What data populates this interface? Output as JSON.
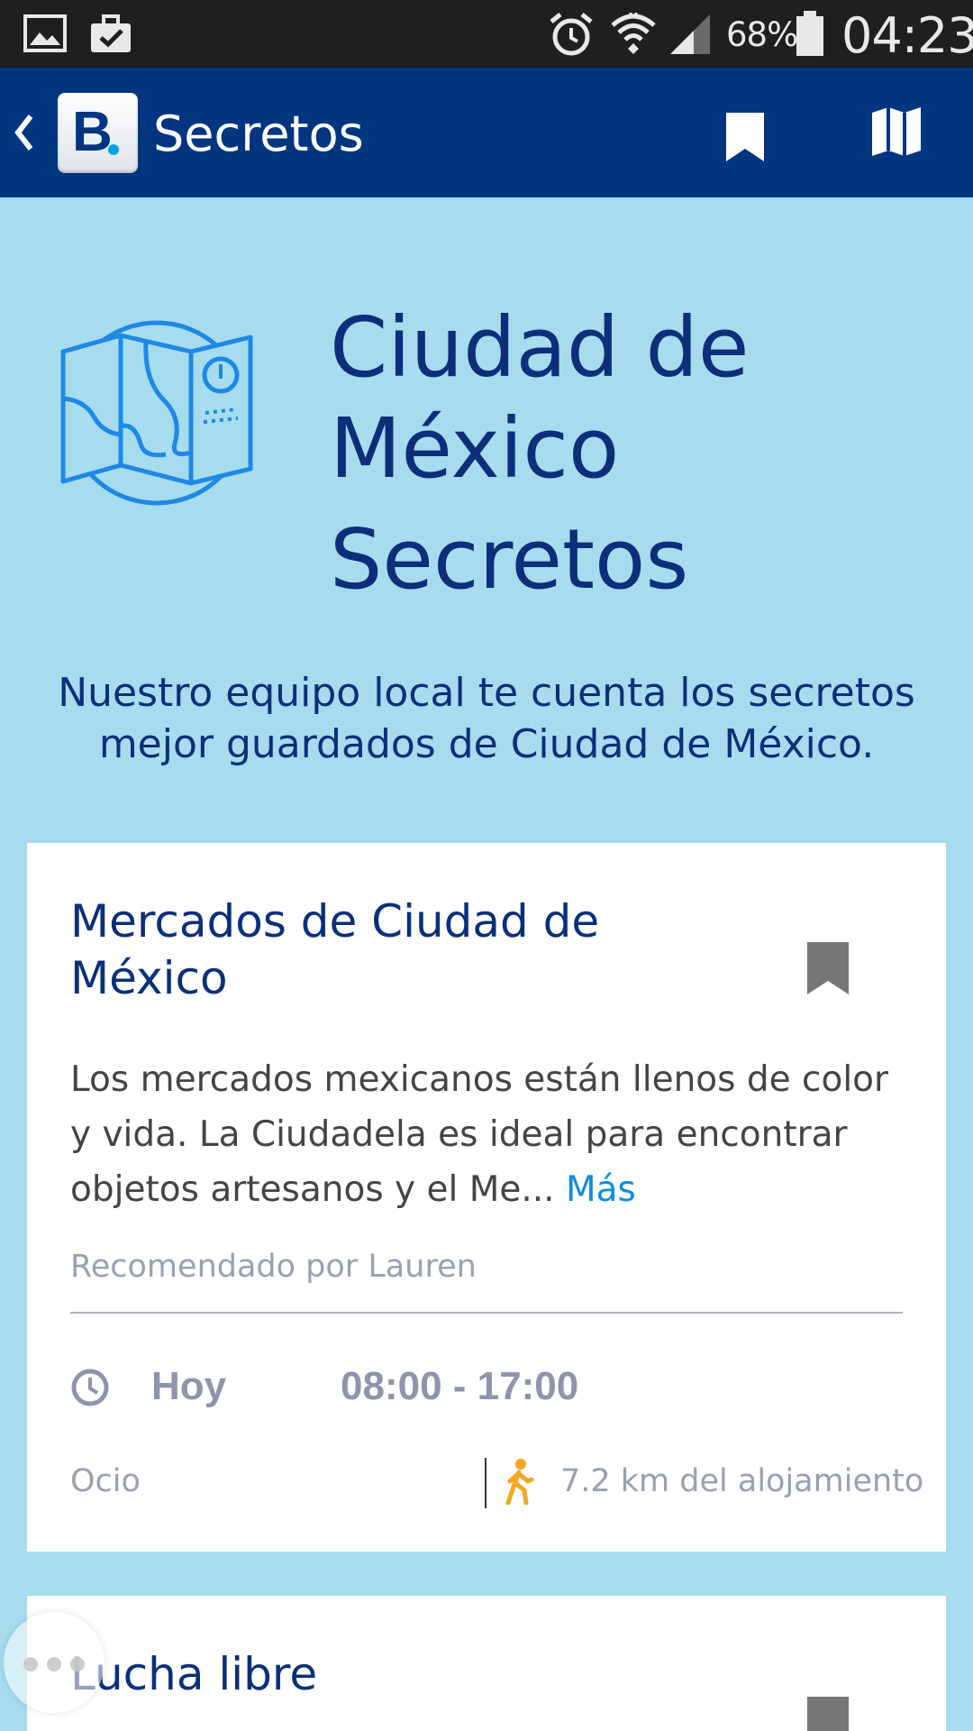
{
  "status_bar": {
    "battery": "68%",
    "time": "04:23"
  },
  "app_bar": {
    "title": "Secretos"
  },
  "hero": {
    "title_line1": "Ciudad de",
    "title_line2": "México",
    "subtitle": "Secretos",
    "description": "Nuestro equipo local te cuenta los secretos mejor guardados de Ciudad de México."
  },
  "cards": [
    {
      "title": "Mercados de Ciudad de México",
      "description": "Los mercados mexicanos están llenos de color y vida. La Ciudadela es ideal para encontrar objetos artesanos y el Me...",
      "more_label": "Más",
      "recommended": "Recomendado por Lauren",
      "day": "Hoy",
      "hours": "08:00 - 17:00",
      "category": "Ocio",
      "distance": "7.2 km del alojamiento"
    },
    {
      "title": "Lucha libre"
    }
  ],
  "colors": {
    "app_bar": "#003580",
    "background": "#a6dcee",
    "heading": "#0b2f7a",
    "link": "#0d8de0",
    "walk_icon": "#f5a623"
  }
}
